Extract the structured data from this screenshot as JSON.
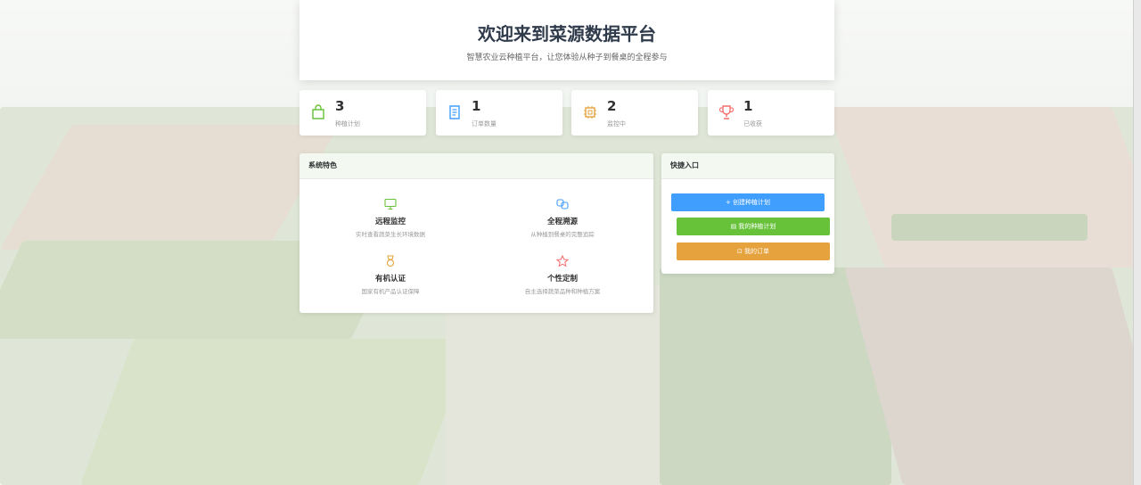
{
  "hero": {
    "title": "欢迎来到菜源数据平台",
    "subtitle": "智慧农业云种植平台，让您体验从种子到餐桌的全程参与"
  },
  "stats": [
    {
      "value": "3",
      "label": "种植计划",
      "icon": "shopping-bag-icon",
      "color": "#67c23a"
    },
    {
      "value": "1",
      "label": "订单数量",
      "icon": "document-icon",
      "color": "#409eff"
    },
    {
      "value": "2",
      "label": "监控中",
      "icon": "chip-icon",
      "color": "#e6a23c"
    },
    {
      "value": "1",
      "label": "已收获",
      "icon": "trophy-icon",
      "color": "#f56c6c"
    }
  ],
  "features": {
    "title": "系统特色",
    "items": [
      {
        "title": "远程监控",
        "desc": "实时查看蔬菜生长环境数据",
        "icon": "monitor-icon",
        "color": "#67c23a"
      },
      {
        "title": "全程溯源",
        "desc": "从种植到餐桌的完整追踪",
        "icon": "link-icon",
        "color": "#409eff"
      },
      {
        "title": "有机认证",
        "desc": "国家有机产品认证保障",
        "icon": "medal-icon",
        "color": "#e6a23c"
      },
      {
        "title": "个性定制",
        "desc": "自主选择蔬菜品种和种植方案",
        "icon": "star-icon",
        "color": "#f56c6c"
      }
    ]
  },
  "quick": {
    "title": "快捷入口",
    "buttons": [
      {
        "label": "+ 创建种植计划",
        "color": "#409eff",
        "icon": "plus-icon"
      },
      {
        "label": "▤ 我的种植计划",
        "color": "#67c23a",
        "icon": "list-icon"
      },
      {
        "label": "⊡ 我的订单",
        "color": "#e6a23c",
        "icon": "cart-icon"
      }
    ]
  }
}
